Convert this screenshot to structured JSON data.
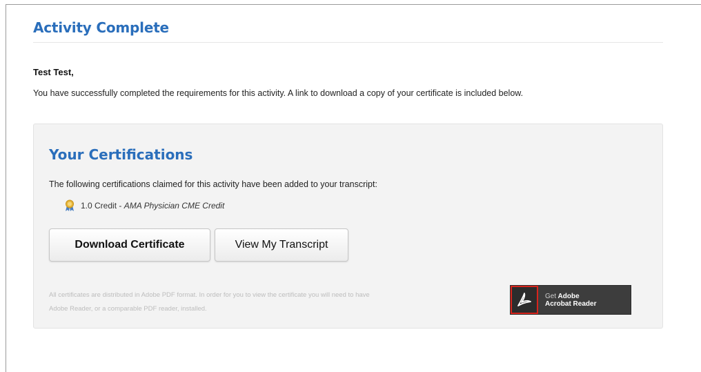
{
  "page": {
    "title": "Activity Complete",
    "greeting": "Test Test,",
    "intro": "You have successfully completed the requirements for this activity. A link to download a copy of your certificate is included below."
  },
  "certifications": {
    "heading": "Your Certifications",
    "description": "The following certifications claimed for this activity have been added to your transcript:",
    "items": [
      {
        "amount": "1.0 Credit",
        "separator": " - ",
        "name": "AMA Physician CME Credit",
        "icon": "award-ribbon-icon"
      }
    ],
    "download_button": "Download Certificate",
    "transcript_button": "View My Transcript",
    "pdf_note_line1": "All certificates are distributed in Adobe PDF format. In order for you to view the certificate you will need to have",
    "pdf_note_line2": "Adobe Reader, or a comparable PDF reader, installed.",
    "adobe_badge": {
      "line1_get": "Get",
      "line1_brand": "Adobe",
      "line2": "Acrobat Reader",
      "icon": "adobe-acrobat-icon"
    }
  },
  "colors": {
    "heading_blue": "#2a6ebb",
    "panel_bg": "#f3f3f3",
    "adobe_red": "#d8241c"
  }
}
